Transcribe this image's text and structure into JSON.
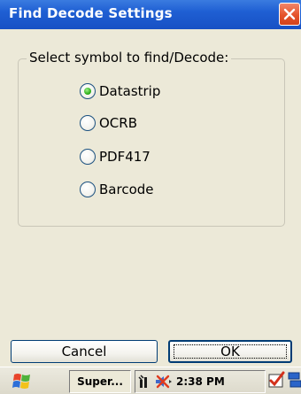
{
  "window": {
    "title": "Find Decode Settings",
    "close_icon": "close-icon"
  },
  "group": {
    "label": "Select symbol to find/Decode:",
    "options": [
      {
        "label": "Datastrip",
        "selected": true
      },
      {
        "label": "OCRB",
        "selected": false
      },
      {
        "label": "PDF417",
        "selected": false
      },
      {
        "label": "Barcode",
        "selected": false
      }
    ]
  },
  "buttons": {
    "cancel_label": "Cancel",
    "ok_label": "OK"
  },
  "taskbar": {
    "task_label": "Super...",
    "clock": "2:38 PM",
    "icons": [
      "windows-flag-icon",
      "network-icon",
      "speaker-muted-icon",
      "checkmark-icon",
      "windows-list-icon"
    ]
  },
  "colors": {
    "titlebar": "#1f5fd3",
    "close": "#e5532a",
    "background": "#ece9d8",
    "radio_selected": "#2fb11c"
  }
}
